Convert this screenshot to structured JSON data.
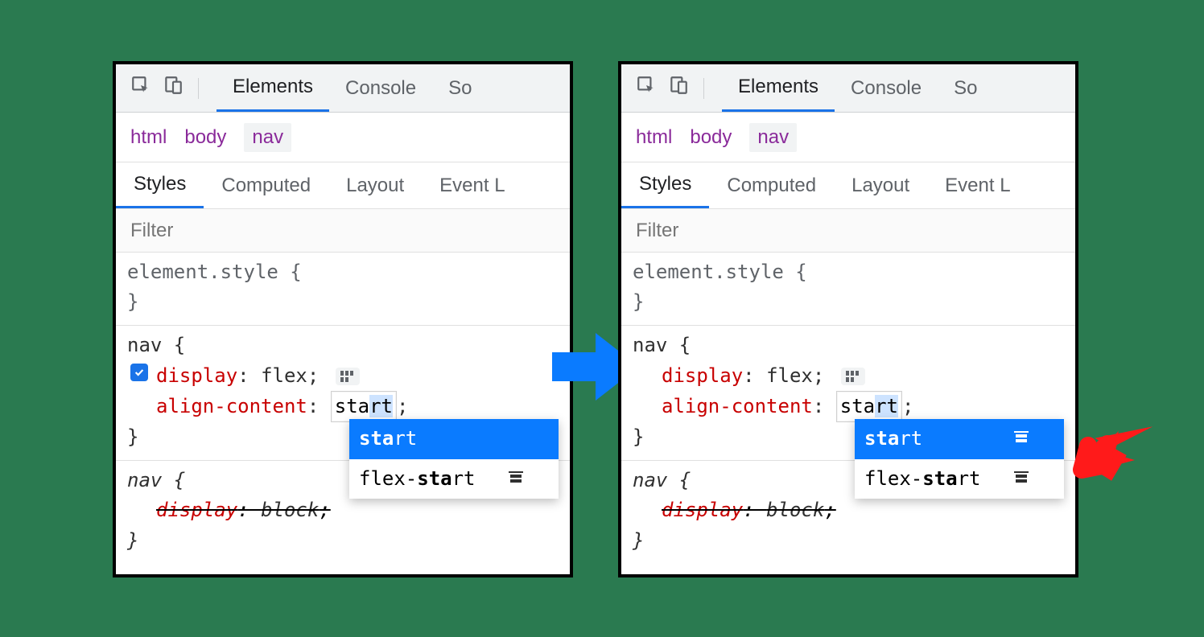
{
  "topTabs": {
    "elements": "Elements",
    "console": "Console",
    "sources": "So"
  },
  "breadcrumb": {
    "html": "html",
    "body": "body",
    "nav": "nav"
  },
  "subTabs": {
    "styles": "Styles",
    "computed": "Computed",
    "layout": "Layout",
    "events": "Event L"
  },
  "filter": {
    "placeholder": "Filter"
  },
  "rule1": {
    "selector": "element.style {",
    "close": "}"
  },
  "rule2": {
    "selector": "nav {",
    "p1_name": "display",
    "p1_val": "flex",
    "p2_name": "align-content",
    "p2_val_typed_sta": "sta",
    "p2_val_typed_rt": "rt",
    "close": "}"
  },
  "rule3": {
    "selector": "nav {",
    "p1_name": "display",
    "p1_val": "block",
    "close": "}"
  },
  "ac": {
    "opt1_bold": "sta",
    "opt1_rest": "rt",
    "opt2_pre": "flex-",
    "opt2_bold": "sta",
    "opt2_rest": "rt"
  }
}
